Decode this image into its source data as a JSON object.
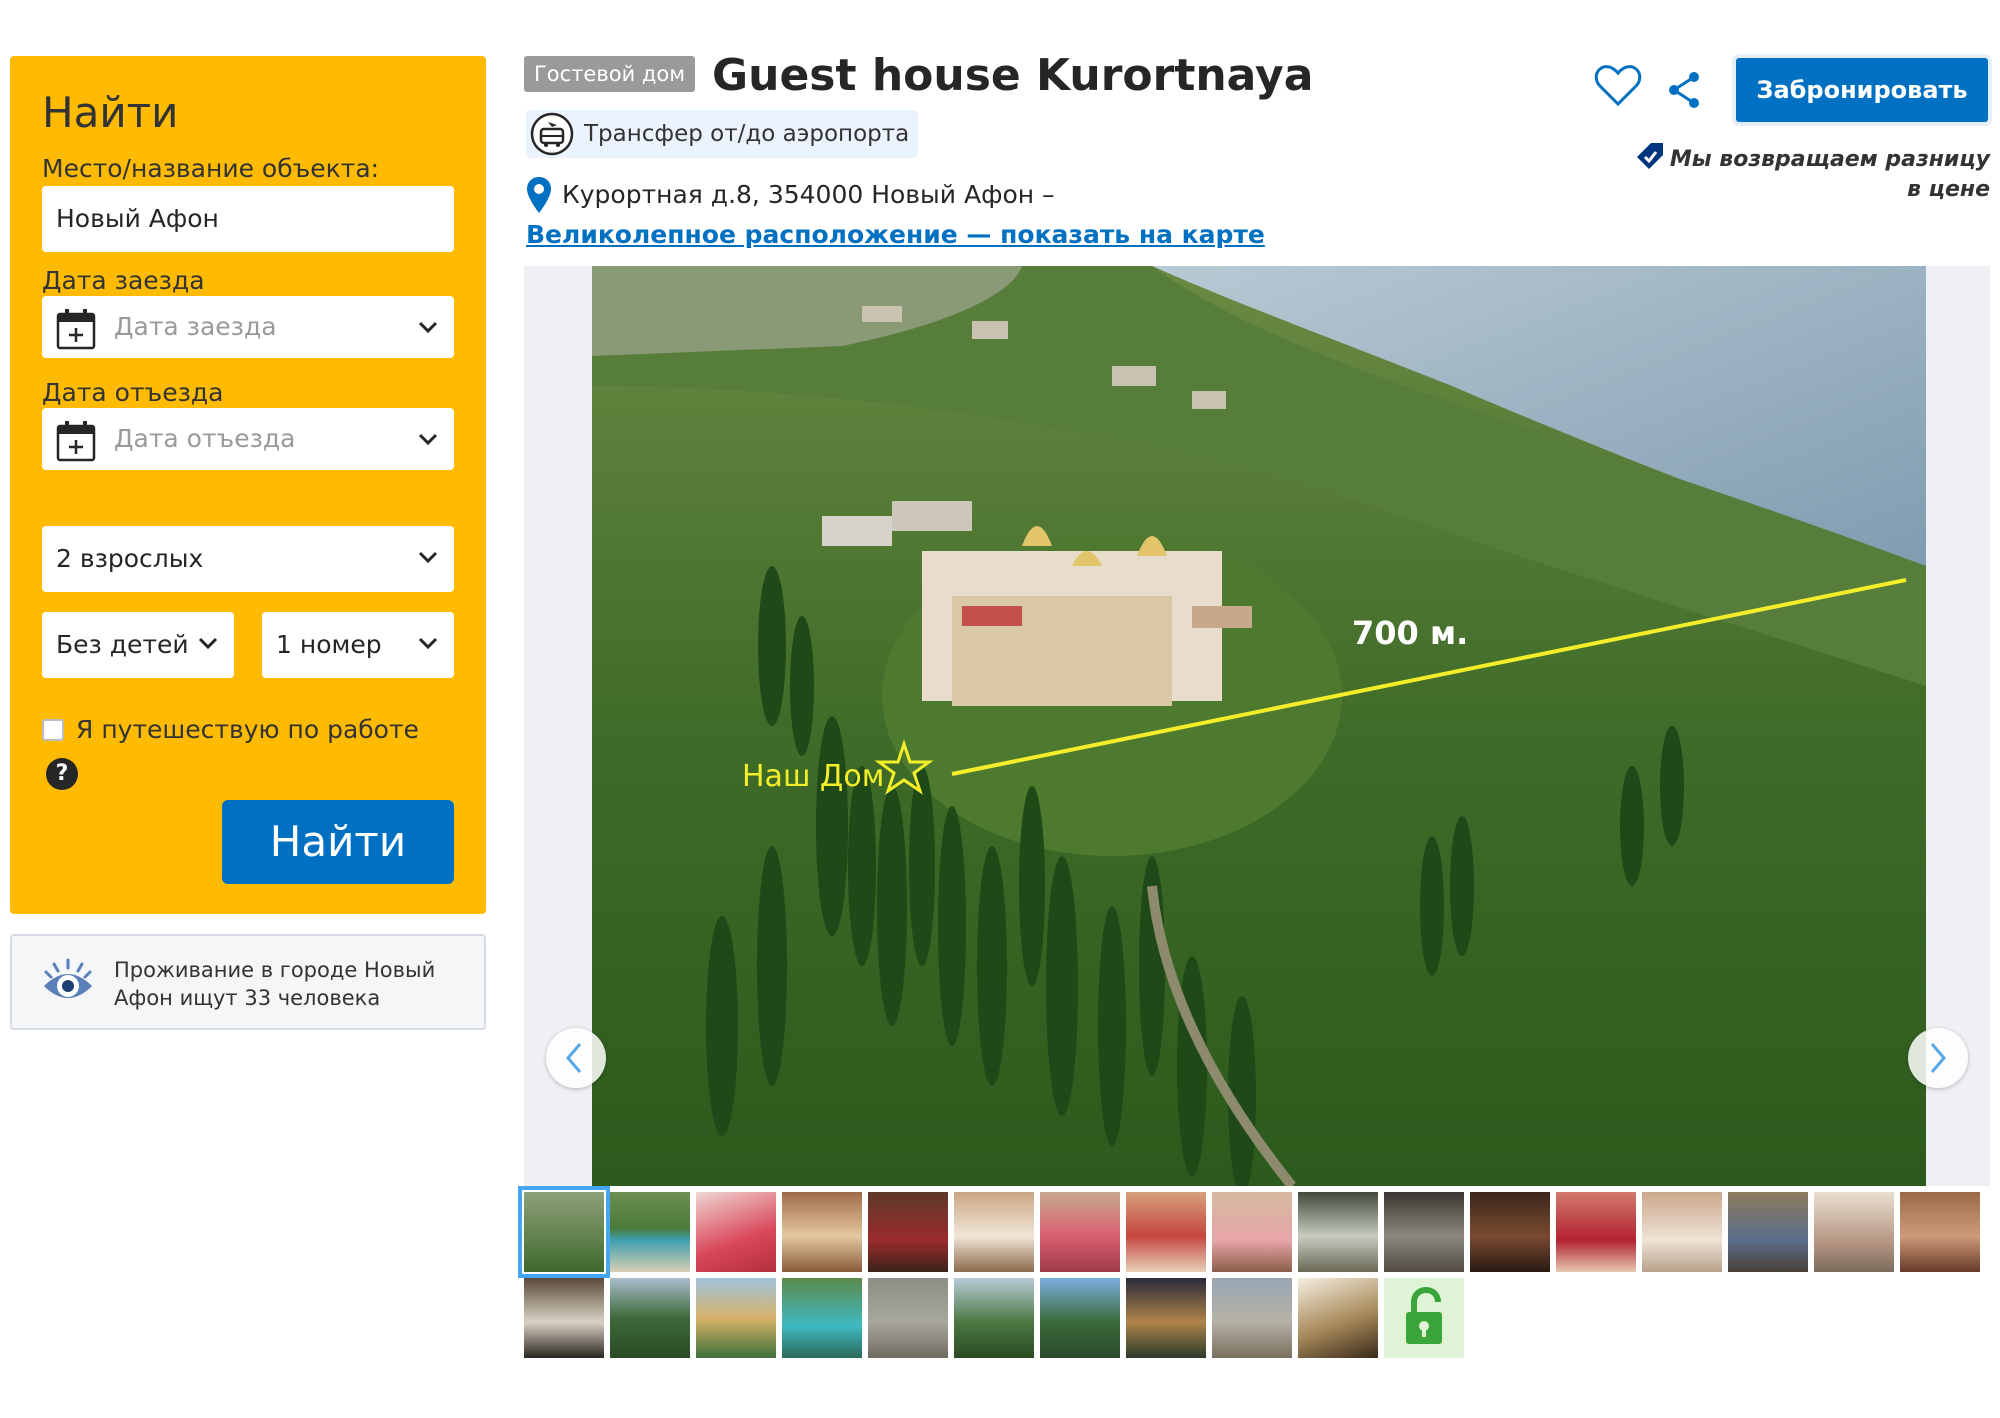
{
  "search": {
    "title": "Найти",
    "destination_label": "Место/название объекта:",
    "destination_value": "Новый Афон",
    "checkin_label": "Дата заезда",
    "checkin_placeholder": "Дата заезда",
    "checkout_label": "Дата отъезда",
    "checkout_placeholder": "Дата отъезда",
    "adults": "2 взрослых",
    "children": "Без детей",
    "rooms": "1 номер",
    "business_text": "Я путешествую по работе",
    "help_glyph": "?",
    "search_button": "Найти"
  },
  "viewers": {
    "text": "Проживание в городе Новый Афон ищут 33 человека",
    "icon": "eye-icon"
  },
  "property": {
    "type_badge": "Гостевой дом",
    "name": "Guest house Kurortnaya",
    "transfer": "Трансфер от/до аэропорта",
    "address": "Курортная д.8, 354000 Новый Афон –",
    "map_link": "Великолепное расположение — показать на карте"
  },
  "actions": {
    "book_button": "Забронировать",
    "price_match": "Мы возвращаем разницу в цене",
    "favorite_icon": "heart-icon",
    "share_icon": "share-icon"
  },
  "photo": {
    "annotation_distance": "700 м.",
    "annotation_home": "Наш Дом"
  },
  "gallery": {
    "thumbnail_count": 28,
    "active_index": 0,
    "locked_icon": "unlock-icon"
  },
  "colors": {
    "search_bg": "#febb02",
    "primary": "#0071c2",
    "badge": "#9a9a9a"
  }
}
